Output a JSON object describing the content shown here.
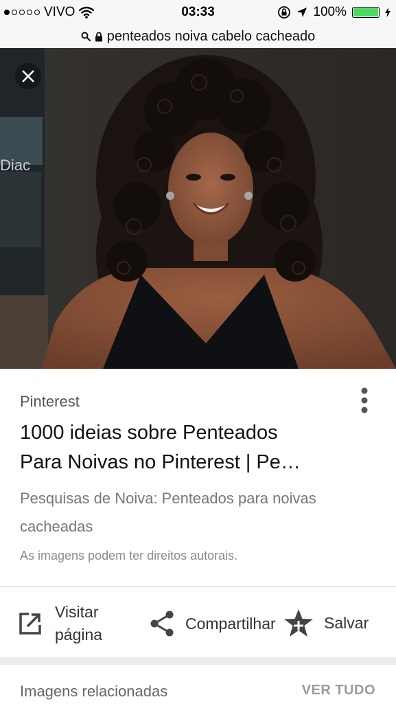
{
  "status_bar": {
    "carrier": "VIVO",
    "time": "03:33",
    "battery": "100%",
    "signal_strength": 1,
    "signal_max": 5
  },
  "url_bar": {
    "query": "penteados noiva cabelo cacheado"
  },
  "result": {
    "source": "Pinterest",
    "title_line1": "1000 ideias sobre Penteados",
    "title_line2": "Para Noivas no Pinterest | Pe…",
    "desc_line1": "Pesquisas de Noiva: Penteados para noivas",
    "desc_line2": "cacheadas",
    "copyright": "As imagens podem ter direitos autorais."
  },
  "actions": {
    "visit_line1": "Visitar",
    "visit_line2": "página",
    "share": "Compartilhar",
    "save": "Salvar"
  },
  "related": {
    "label": "Imagens relacionadas",
    "see_all": "VER TUDO"
  },
  "colors": {
    "battery_fill": "#4cd964",
    "status_bg": "#f7f7f7",
    "card_bg": "#ffffff",
    "page_bg": "#ececec"
  }
}
